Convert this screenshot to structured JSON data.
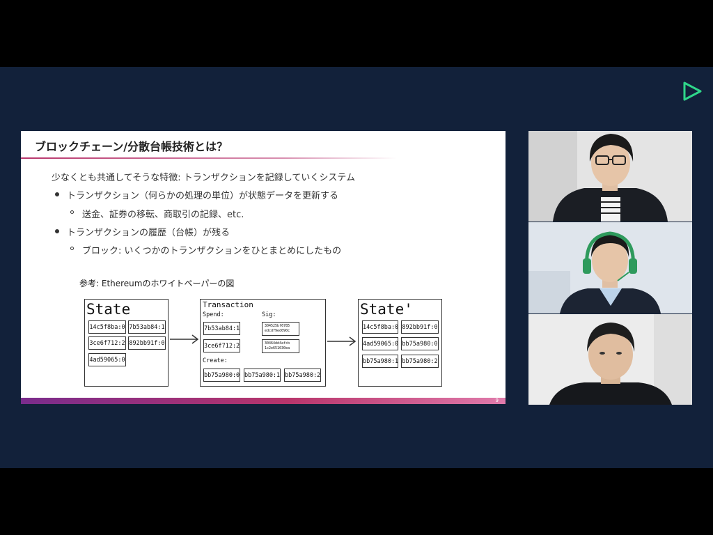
{
  "app": {
    "accent": "#2fd68a",
    "logo_icon": "play-triangle-logo"
  },
  "slide": {
    "title": "ブロックチェーン/分散台帳技術とは？",
    "intro": "少なくとも共通してそうな特徴: トランザクションを記録していくシステム",
    "bullets": [
      {
        "text": "トランザクション（何らかの処理の単位）が状態データを更新する",
        "sub": [
          "送金、証券の移転、商取引の記録、etc."
        ]
      },
      {
        "text": "トランザクションの履歴（台帳）が残る",
        "sub": [
          "ブロック: いくつかのトランザクションをひとまとめにしたもの"
        ]
      }
    ],
    "reference": "参考: Ethereumのホワイトペーパーの図",
    "page_number": "9",
    "diagram": {
      "state": {
        "title": "State",
        "cells": [
          "14c5f8ba:0",
          "7b53ab84:1",
          "3ce6f712:2",
          "892bb91f:0",
          "4ad59065:0"
        ]
      },
      "transaction": {
        "title": "Transaction",
        "spend_label": "Spend:",
        "spend": [
          "7b53ab84:1",
          "3ce6f712:2"
        ],
        "sig_label": "Sig:",
        "sigs": [
          [
            "304525bf6785",
            "edcd79ed090c"
          ],
          [
            "30464dd4afcb",
            "1c2e651030ea"
          ]
        ],
        "create_label": "Create:",
        "create": [
          "bb75a980:0",
          "bb75a980:1",
          "bb75a980:2"
        ]
      },
      "new_state": {
        "title": "State'",
        "cells": [
          "14c5f8ba:0",
          "892bb91f:0",
          "4ad59065:0",
          "bb75a980:0",
          "bb75a980:1",
          "bb75a980:2"
        ]
      }
    }
  },
  "participants": [
    {
      "shirt": "#1b1e24",
      "bg": "#e2e2e2"
    },
    {
      "shirt": "#1c2433",
      "bg": "#dbe2ea",
      "headset": "#2e9a5c"
    },
    {
      "shirt": "#16181c",
      "bg": "#e8e8e8"
    }
  ]
}
